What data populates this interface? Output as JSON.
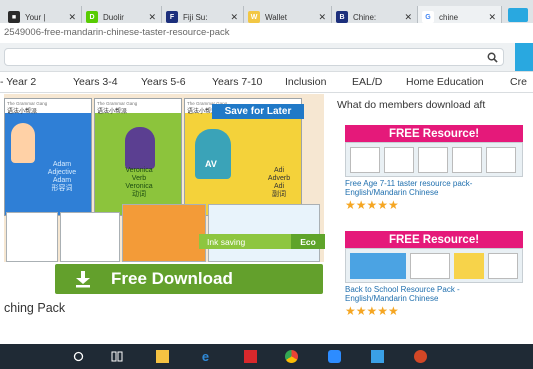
{
  "tabs": [
    {
      "title": "Your |",
      "favicon_color": "#2b2b2b",
      "favicon_text": "■"
    },
    {
      "title": "Duolir",
      "favicon_color": "#58cc02",
      "favicon_text": "D"
    },
    {
      "title": "Fiji Su:",
      "favicon_color": "#1c2f7c",
      "favicon_text": "F"
    },
    {
      "title": "Wallet",
      "favicon_color": "#f2c744",
      "favicon_text": "W"
    },
    {
      "title": "Chine:",
      "favicon_color": "#1c2f7c",
      "favicon_text": "B"
    },
    {
      "title": "chine",
      "favicon_color": "#ffffff",
      "favicon_text": "G"
    }
  ],
  "url": "2549006-free-mandarin-chinese-taster-resource-pack",
  "search": {
    "placeholder": ""
  },
  "nav": [
    "- Year 2",
    "Years 3-4",
    "Years 5-6",
    "Years 7-10",
    "Inclusion",
    "EAL/D",
    "Home Education",
    "Cre"
  ],
  "product": {
    "save_label": "Save for Later",
    "ink_saving_label": "Ink saving",
    "eco_label": "Eco",
    "download_label": "Free Download",
    "title": "ching Pack",
    "sheets": [
      {
        "gang": "The Grammar Gang",
        "cn": "语法小帮派",
        "color": "#2f7fd6",
        "words": [
          "Adam",
          "Adjective",
          "Adam",
          "形容词"
        ]
      },
      {
        "gang": "The Grammar Gang",
        "cn": "语法小帮派",
        "color": "#8cc43c",
        "words": [
          "Veronica",
          "Verb",
          "Veronica",
          "动词"
        ]
      },
      {
        "gang": "The Grammar Gang",
        "cn": "语法小帮派",
        "color": "#f4d23a",
        "words": [
          "Adi",
          "Adverb",
          "Adi",
          "副词"
        ]
      }
    ],
    "badge_letters": "AV"
  },
  "sidebar": {
    "title": "What do members download aft",
    "cards": [
      {
        "banner": "FREE Resource!",
        "title": "Free Age 7-11 taster resource pack-English/Mandarin Chinese",
        "stars": "★★★★★"
      },
      {
        "banner": "FREE Resource!",
        "title": "Back to School Resource Pack - English/Mandarin Chinese",
        "stars": "★★★★★"
      }
    ]
  },
  "taskbar": [
    {
      "name": "cortana-icon",
      "color": "#ffffff"
    },
    {
      "name": "task-view-icon",
      "color": "#ffffff"
    },
    {
      "name": "file-explorer-icon",
      "color": "#f5c242"
    },
    {
      "name": "edge-icon",
      "color": "#2f8ad8"
    },
    {
      "name": "acrobat-icon",
      "color": "#d8282c"
    },
    {
      "name": "chrome-icon",
      "color": "#4caf50"
    },
    {
      "name": "zoom-icon",
      "color": "#2d8cff"
    },
    {
      "name": "network-icon",
      "color": "#3aa0e6"
    },
    {
      "name": "powerpoint-icon",
      "color": "#d24726"
    }
  ],
  "colors": {
    "download_green": "#63a02c",
    "eco_green": "#8dc63f",
    "resource_pink": "#e5197a",
    "save_blue": "#2079c7"
  }
}
